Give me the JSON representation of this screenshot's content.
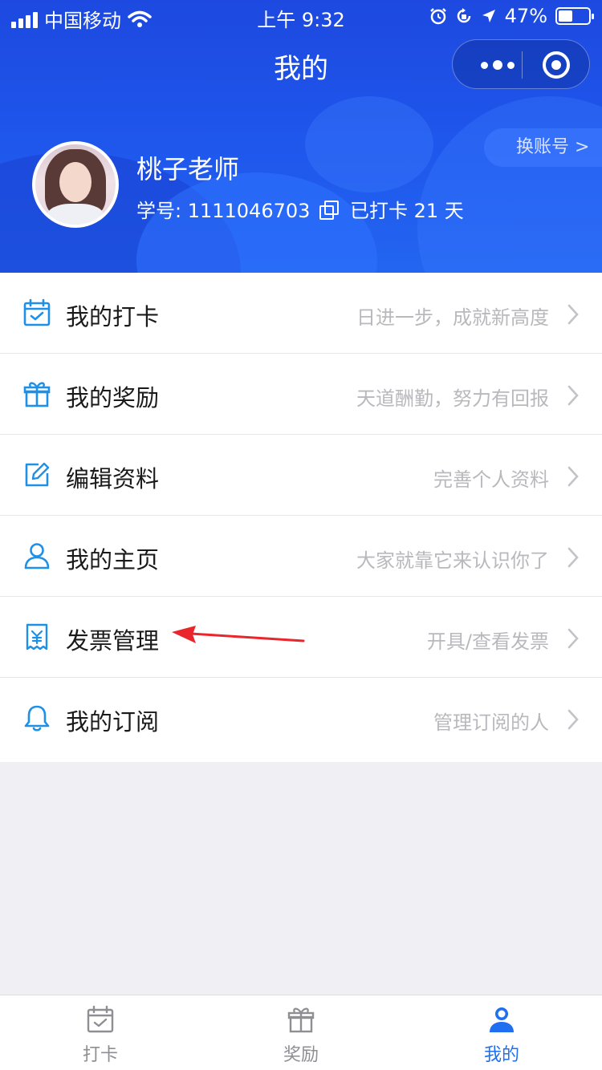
{
  "status_bar": {
    "carrier": "中国移动",
    "time": "上午 9:32",
    "battery_text": "47%",
    "battery_level": 0.47
  },
  "nav": {
    "title": "我的",
    "capsule_icons": [
      "more-dots-icon",
      "target-icon"
    ]
  },
  "profile": {
    "switch_account": "换账号 >",
    "name": "桃子老师",
    "student_id": "学号: 1111046703",
    "checkin": "已打卡 21 天"
  },
  "menu": {
    "items": [
      {
        "label": "我的打卡",
        "hint": "日进一步，成就新高度",
        "icon": "calendar-check-icon"
      },
      {
        "label": "我的奖励",
        "hint": "天道酬勤，努力有回报",
        "icon": "gift-icon"
      },
      {
        "label": "编辑资料",
        "hint": "完善个人资料",
        "icon": "edit-icon"
      },
      {
        "label": "我的主页",
        "hint": "大家就靠它来认识你了",
        "icon": "user-icon"
      },
      {
        "label": "发票管理",
        "hint": "开具/查看发票",
        "icon": "invoice-icon"
      },
      {
        "label": "我的订阅",
        "hint": "管理订阅的人",
        "icon": "bell-icon"
      }
    ]
  },
  "tabbar": {
    "tabs": [
      {
        "label": "打卡",
        "icon": "calendar-check-icon",
        "active": false
      },
      {
        "label": "奖励",
        "icon": "gift-icon",
        "active": false
      },
      {
        "label": "我的",
        "icon": "user-icon",
        "active": true
      }
    ]
  },
  "colors": {
    "brand_blue": "#1f57ec",
    "icon_blue": "#1e90e8",
    "active_tab": "#1f6ff0",
    "annotation_red": "#e8262b"
  }
}
